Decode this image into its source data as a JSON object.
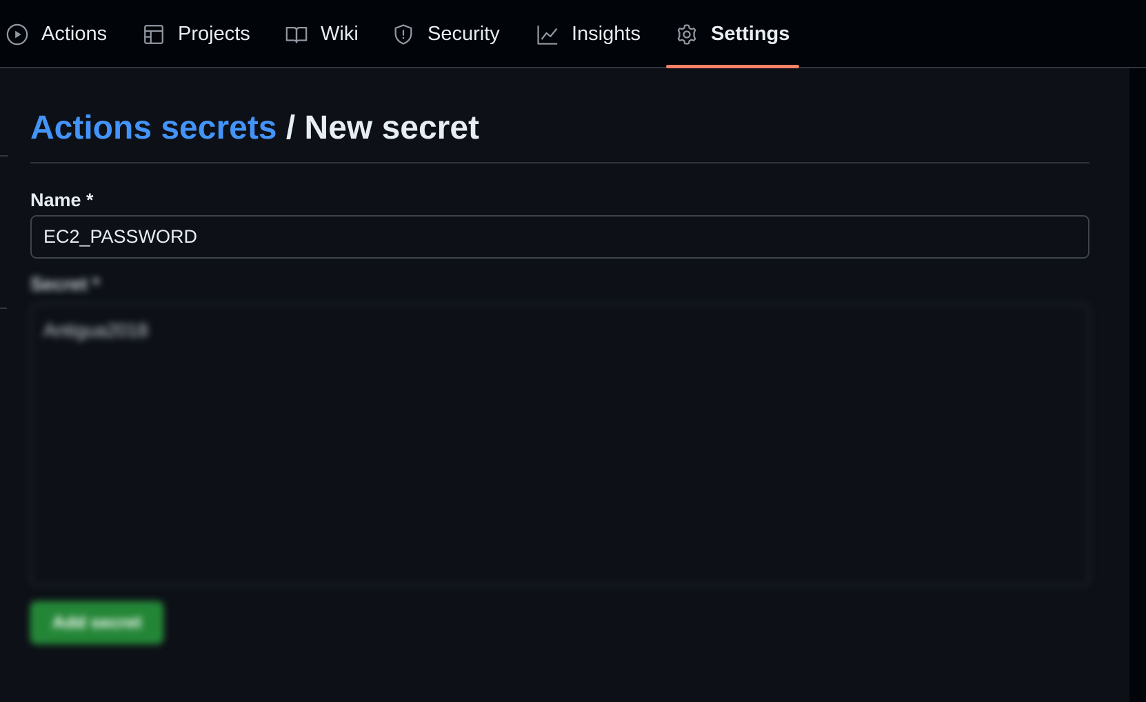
{
  "nav": {
    "tabs": [
      {
        "label": "Actions",
        "icon": "play-icon"
      },
      {
        "label": "Projects",
        "icon": "table-icon"
      },
      {
        "label": "Wiki",
        "icon": "book-icon"
      },
      {
        "label": "Security",
        "icon": "shield-icon"
      },
      {
        "label": "Insights",
        "icon": "graph-icon"
      },
      {
        "label": "Settings",
        "icon": "gear-icon",
        "active": true
      }
    ],
    "active_color": "#f78166"
  },
  "page": {
    "breadcrumb_link": "Actions secrets",
    "separator": "/",
    "current": "New secret"
  },
  "form": {
    "name_label": "Name *",
    "name_value": "EC2_PASSWORD",
    "secret_label": "Secret *",
    "secret_value": "Antigua2018",
    "submit_label": "Add secret"
  },
  "colors": {
    "link": "#4493f8",
    "primary_button": "#238636",
    "background": "#0d1117"
  }
}
